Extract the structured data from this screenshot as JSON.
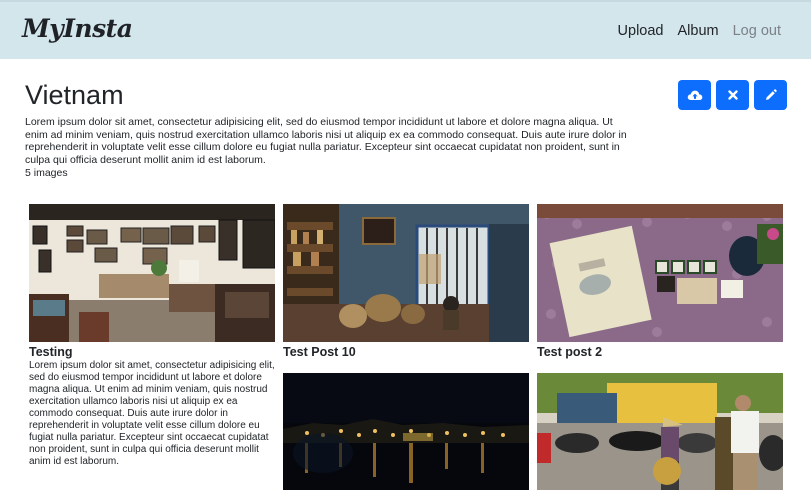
{
  "navbar": {
    "brand": "MyInsta",
    "links": [
      {
        "label": "Upload"
      },
      {
        "label": "Album"
      },
      {
        "label": "Log out"
      }
    ]
  },
  "album": {
    "title": "Vietnam",
    "description": "Lorem ipsum dolor sit amet, consectetur adipisicing elit, sed do eiusmod tempor incididunt ut labore et dolore magna aliqua. Ut enim ad minim veniam, quis nostrud exercitation ullamco laboris nisi ut aliquip ex ea commodo consequat. Duis aute irure dolor in reprehenderit in voluptate velit esse cillum dolore eu fugiat nulla pariatur. Excepteur sint occaecat cupidatat non proident, sunt in culpa qui officia deserunt mollit anim id est laborum.",
    "image_count": "5 images"
  },
  "actions": [
    {
      "icon": "cloud-upload-icon"
    },
    {
      "icon": "close-icon"
    },
    {
      "icon": "pencil-icon"
    }
  ],
  "posts": [
    {
      "title": "Testing",
      "text": "Lorem ipsum dolor sit amet, consectetur adipisicing elit, sed do eiusmod tempor incididunt ut labore et dolore magna aliqua. Ut enim ad minim veniam, quis nostrud exercitation ullamco laboris nisi ut aliquip ex ea commodo consequat. Duis aute irure dolor in reprehenderit in voluptate velit esse cillum dolore eu fugiat nulla pariatur. Excepteur sint occaecat cupidatat non proident, sunt in culpa qui officia deserunt mollit anim id est laborum."
    },
    {
      "title": "Test Post 10"
    },
    {
      "title": "Test post 2"
    },
    {
      "title": ""
    },
    {
      "title": ""
    }
  ],
  "colors": {
    "navbar_bg": "#d3e6ec",
    "primary": "#0d6efd",
    "muted_link": "#7b8187"
  }
}
